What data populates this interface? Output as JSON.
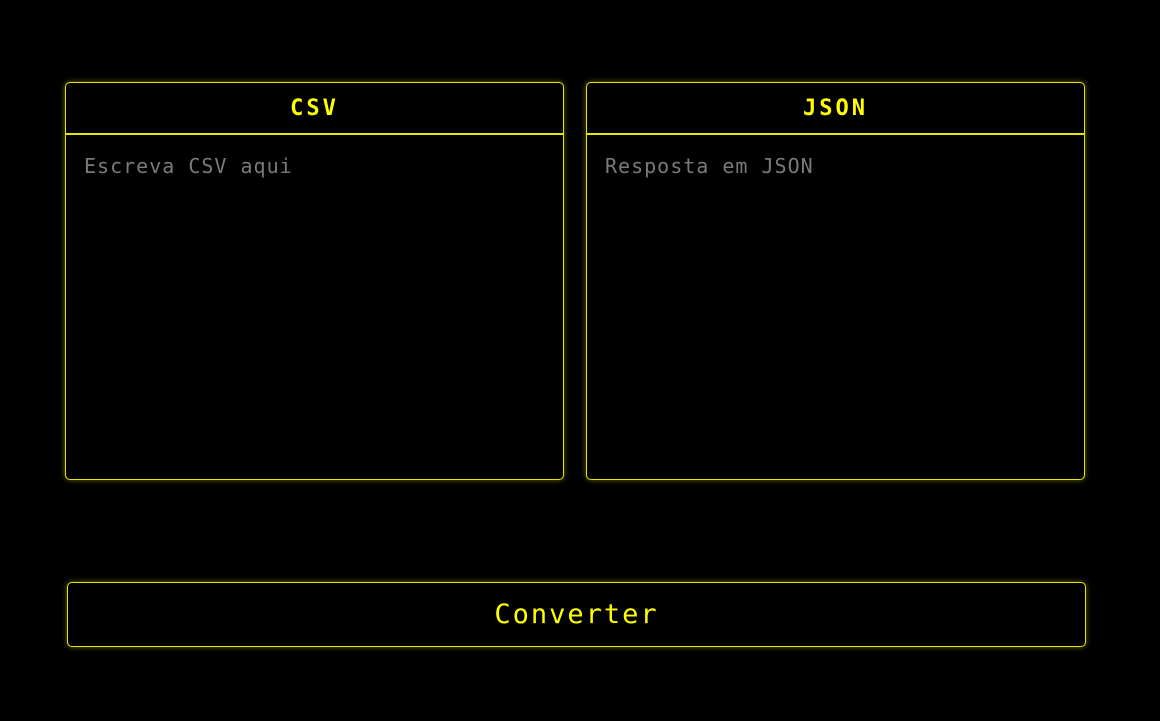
{
  "csv_panel": {
    "title": "CSV",
    "placeholder": "Escreva CSV aqui",
    "value": ""
  },
  "json_panel": {
    "title": "JSON",
    "placeholder": "Resposta em JSON",
    "value": ""
  },
  "convert_button": {
    "label": "Converter"
  },
  "colors": {
    "background": "#000000",
    "accent": "#e6e600",
    "accent_text": "#ffff00",
    "placeholder": "#7a7a7a"
  }
}
